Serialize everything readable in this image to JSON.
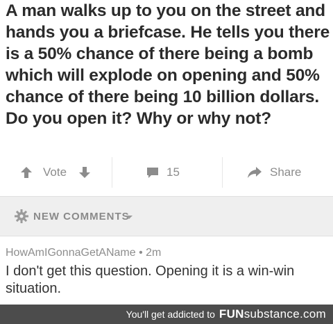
{
  "question": {
    "text": "A man walks up to you on the street and hands you a briefcase. He tells you there is a 50% chance of there being a bomb which will explode on opening and 50% chance of there being 10 billion dollars. Do you open it? Why or why not?"
  },
  "actions": {
    "vote_label": "Vote",
    "comment_count": "15",
    "share_label": "Share",
    "icon_color": "#8c8c8c"
  },
  "comments_header": {
    "title": "NEW COMMENTS"
  },
  "comment": {
    "meta": "HowAmIGonnaGetAName • 2m",
    "body": "I don't get this question. Opening it is a win-win situation."
  },
  "footer": {
    "tagline": "You'll get addicted to",
    "brand_bold": "FUN",
    "brand_rest": "substance.com",
    "background": "#4c4c4c"
  }
}
